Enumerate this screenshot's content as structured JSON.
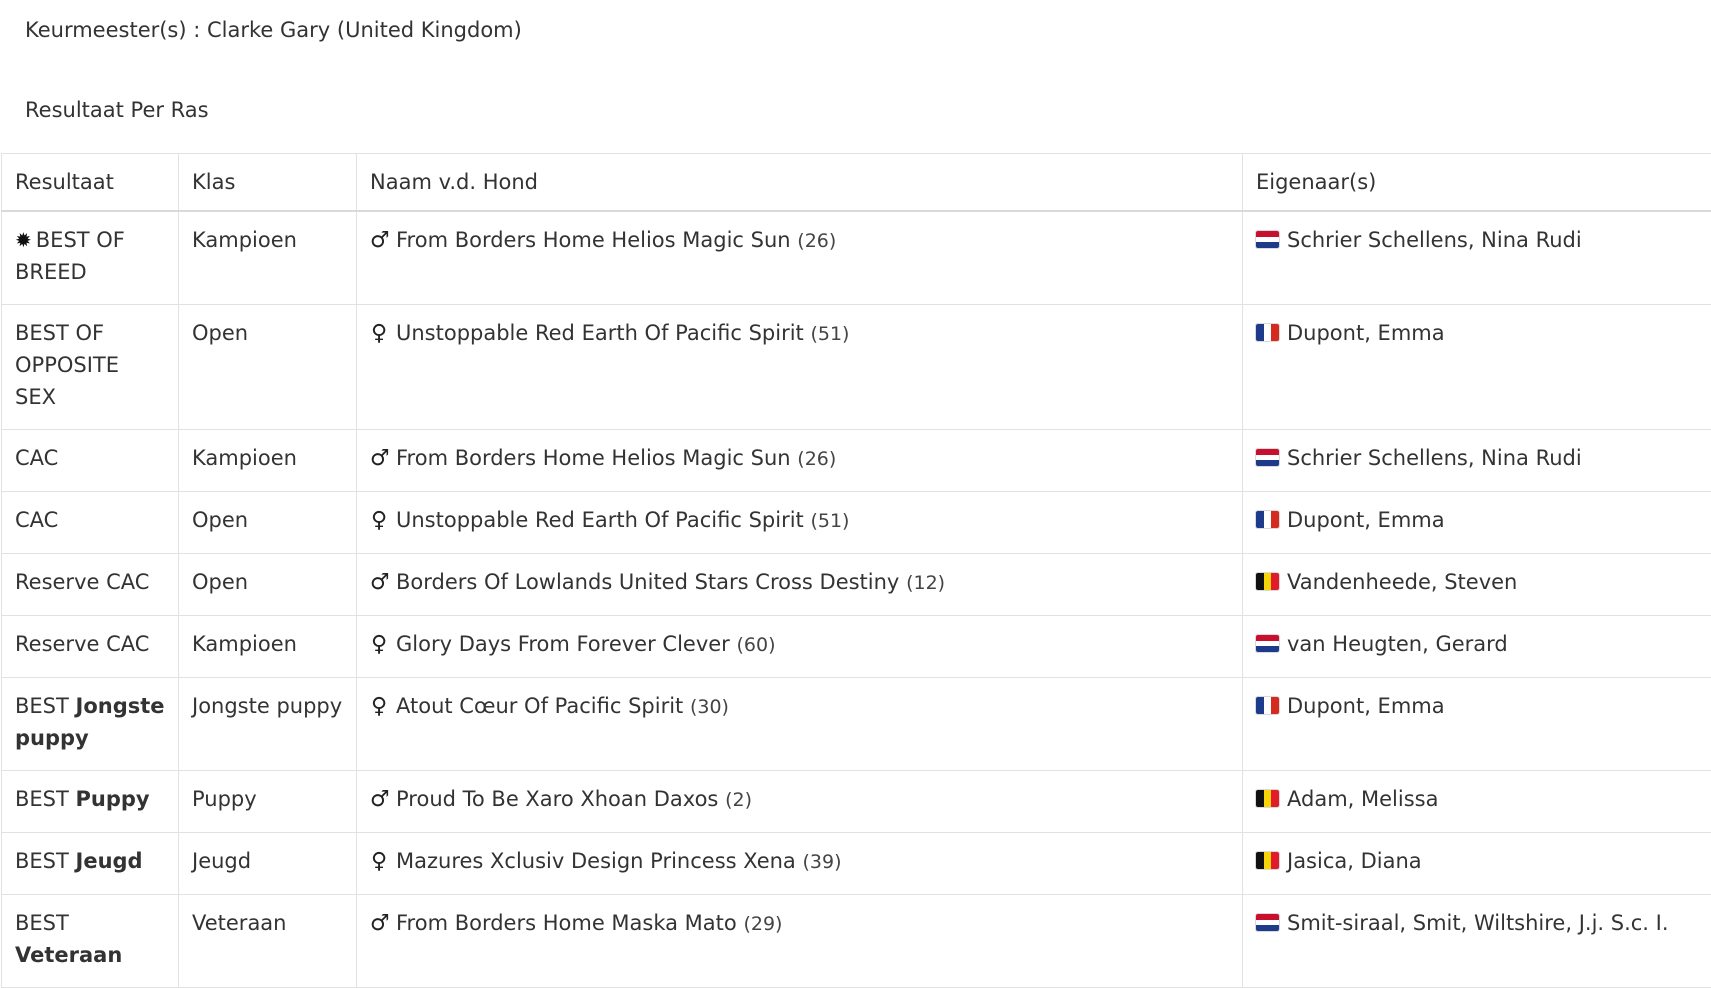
{
  "judges": "Keurmeester(s) : Clarke Gary (United Kingdom)",
  "section_title": "Resultaat Per Ras",
  "columns": [
    "Resultaat",
    "Klas",
    "Naam v.d. Hond",
    "Eigenaar(s)"
  ],
  "flags": {
    "nl": [
      "#c8102e",
      "#ffffff",
      "#1e3a8a"
    ],
    "fr": [
      "#1e3a8a",
      "#ffffff",
      "#d52b1e"
    ],
    "be": [
      "#111111",
      "#f5d50a",
      "#e21b2a"
    ]
  },
  "rows": [
    {
      "badge": "✹",
      "result": "BEST OF BREED",
      "result_bold": "",
      "klas": "Kampioen",
      "sex": "♂",
      "sex_icon": "male-icon",
      "dog": "From Borders Home Helios Magic Sun",
      "number": "(26)",
      "flag": "nl",
      "owner": "Schrier Schellens, Nina Rudi"
    },
    {
      "badge": "",
      "result": "BEST OF OPPOSITE SEX",
      "result_bold": "",
      "klas": "Open",
      "sex": "♀",
      "sex_icon": "female-icon",
      "dog": "Unstoppable Red Earth Of Pacific Spirit",
      "number": "(51)",
      "flag": "fr",
      "owner": "Dupont, Emma"
    },
    {
      "badge": "",
      "result": "CAC",
      "result_bold": "",
      "klas": "Kampioen",
      "sex": "♂",
      "sex_icon": "male-icon",
      "dog": "From Borders Home Helios Magic Sun",
      "number": "(26)",
      "flag": "nl",
      "owner": "Schrier Schellens, Nina Rudi"
    },
    {
      "badge": "",
      "result": "CAC",
      "result_bold": "",
      "klas": "Open",
      "sex": "♀",
      "sex_icon": "female-icon",
      "dog": "Unstoppable Red Earth Of Pacific Spirit",
      "number": "(51)",
      "flag": "fr",
      "owner": "Dupont, Emma"
    },
    {
      "badge": "",
      "result": "Reserve CAC",
      "result_bold": "",
      "klas": "Open",
      "sex": "♂",
      "sex_icon": "male-icon",
      "dog": "Borders Of Lowlands United Stars Cross Destiny",
      "number": "(12)",
      "flag": "be",
      "owner": "Vandenheede, Steven"
    },
    {
      "badge": "",
      "result": "Reserve CAC",
      "result_bold": "",
      "klas": "Kampioen",
      "sex": "♀",
      "sex_icon": "female-icon",
      "dog": "Glory Days From Forever Clever",
      "number": "(60)",
      "flag": "nl",
      "owner": "van Heugten, Gerard"
    },
    {
      "badge": "",
      "result": "BEST ",
      "result_bold": "Jongste puppy",
      "klas": "Jongste puppy",
      "sex": "♀",
      "sex_icon": "female-icon",
      "dog": "Atout Cœur Of Pacific Spirit",
      "number": "(30)",
      "flag": "fr",
      "owner": "Dupont, Emma"
    },
    {
      "badge": "",
      "result": "BEST ",
      "result_bold": "Puppy",
      "klas": "Puppy",
      "sex": "♂",
      "sex_icon": "male-icon",
      "dog": "Proud To Be Xaro Xhoan Daxos",
      "number": "(2)",
      "flag": "be",
      "owner": "Adam, Melissa"
    },
    {
      "badge": "",
      "result": "BEST ",
      "result_bold": "Jeugd",
      "klas": "Jeugd",
      "sex": "♀",
      "sex_icon": "female-icon",
      "dog": "Mazures Xclusiv Design Princess Xena",
      "number": "(39)",
      "flag": "be",
      "owner": "Jasica, Diana"
    },
    {
      "badge": "",
      "result": "BEST ",
      "result_bold": "Veteraan",
      "klas": "Veteraan",
      "sex": "♂",
      "sex_icon": "male-icon",
      "dog": "From Borders Home Maska Mato",
      "number": "(29)",
      "flag": "nl",
      "owner": "Smit-siraal, Smit, Wiltshire, J.j. S.c. I."
    }
  ]
}
